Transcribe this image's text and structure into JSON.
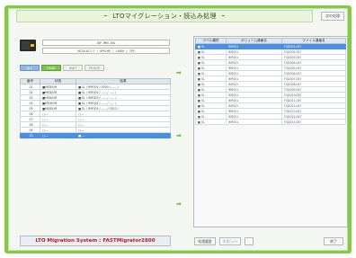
{
  "title": "LTOマイグレーション・読込み処理",
  "title_decoration": "━",
  "top_button": "次の処理",
  "device": {
    "id_line": "INF-MMX-001",
    "model_line": "HE35L017/1 / HPULMO / LA960 / 2PG"
  },
  "filter_tabs": [
    "ALL",
    "READ",
    "WAIT",
    "ERROR"
  ],
  "slot_table": {
    "headers": [
      "番号",
      "状態",
      "結果"
    ],
    "rows": [
      {
        "no": "01",
        "status": "■MEDIUM",
        "result": "■ SL / IMF001 / 0000 / ----- /"
      },
      {
        "no": "02",
        "status": "■MEDIUM",
        "result": "■ SL / IMF002 / ----- / ----- /"
      },
      {
        "no": "03",
        "status": "■MEDIUM",
        "result": "■ SL / IMF003 / ----- / ----- /"
      },
      {
        "no": "04",
        "status": "■MEDIUM",
        "result": "■ SL / IMF004 / ----- / ----- /"
      },
      {
        "no": "05",
        "status": "■MEDIUM",
        "result": "■ SL / IMF005 / ----- / 0303 /"
      },
      {
        "no": "06",
        "status": "□---",
        "result": "□---"
      },
      {
        "no": "07",
        "status": "□---",
        "result": "□---"
      },
      {
        "no": "08",
        "status": "□---",
        "result": "□---"
      },
      {
        "no": "09",
        "status": "□---",
        "result": "□---"
      },
      {
        "no": "10",
        "status": "□---",
        "result": "■ ---"
      }
    ],
    "selected_index": 9
  },
  "file_table": {
    "headers": [
      "ラベル種別",
      "ボリューム通番名",
      "ファイル通番名"
    ],
    "rows": [
      {
        "label": "■ SL",
        "volume": "IMF001",
        "file": "F3J2001.047"
      },
      {
        "label": "■ SL",
        "volume": "IMF001",
        "file": "F3J2002.047"
      },
      {
        "label": "■ SL",
        "volume": "IMF001",
        "file": "F3J2003.047"
      },
      {
        "label": "■ SL",
        "volume": "IMF001",
        "file": "F3J2004.047"
      },
      {
        "label": "■ SL",
        "volume": "IMF001",
        "file": "F3J2005.047"
      },
      {
        "label": "■ SL",
        "volume": "IMF001",
        "file": "F3J2006.047"
      },
      {
        "label": "■ SL",
        "volume": "IMF001",
        "file": "F3J2007.047"
      },
      {
        "label": "■ SL",
        "volume": "IMF001",
        "file": "F3J2008.047"
      },
      {
        "label": "■ SL",
        "volume": "IMF001",
        "file": "F3J2009.047"
      },
      {
        "label": "■ SL",
        "volume": "IMF001",
        "file": "F3J2010.047"
      },
      {
        "label": "■ SL",
        "volume": "IMF001",
        "file": "F3J2011.047"
      },
      {
        "label": "■ SL",
        "volume": "IMF001",
        "file": "F3J2012.047"
      },
      {
        "label": "■ SL",
        "volume": "IMF001",
        "file": "F3J2013.047"
      },
      {
        "label": "■ SL",
        "volume": "IMF001",
        "file": "F3J2014.047"
      },
      {
        "label": "■ SL",
        "volume": "IMF001",
        "file": "F3J2015.047"
      }
    ],
    "selected_index": 0
  },
  "arrow_glyph": "➡",
  "footer": {
    "brand": "LTO Migration System  :  FASTMigrator2800",
    "btn_history": "処理履歴",
    "btn_retry": "再実行(R)",
    "btn_blank": "",
    "btn_end": "終了"
  },
  "colors": {
    "accent_green": "#7fce3c",
    "selection_blue": "#4a90e2",
    "brand_red": "#c01818"
  }
}
